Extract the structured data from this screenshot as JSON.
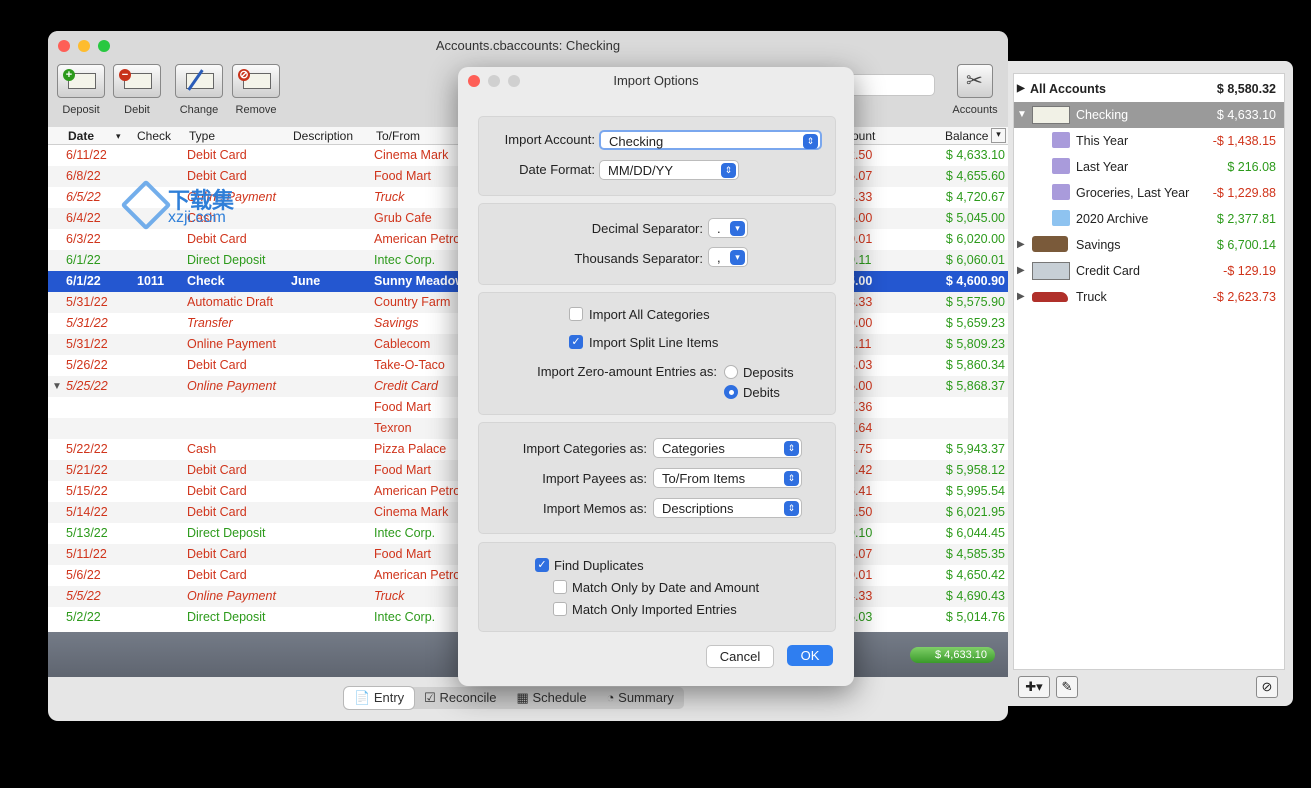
{
  "window": {
    "title": "Accounts.cbaccounts:  Checking"
  },
  "toolbar": {
    "deposit": "Deposit",
    "debit": "Debit",
    "change": "Change",
    "remove": "Remove",
    "accounts": "Accounts"
  },
  "columns": {
    "date": "Date",
    "check": "Check",
    "type": "Type",
    "description": "Description",
    "tofrom": "To/From",
    "amount": "ount",
    "balance": "Balance"
  },
  "rows": [
    {
      "date": "6/11/22",
      "type": "Debit Card",
      "to": "Cinema Mark",
      "amt": "2.50",
      "bal": "$ 4,633.10",
      "c": "red",
      "i": false
    },
    {
      "date": "6/8/22",
      "type": "Debit Card",
      "to": "Food Mart",
      "amt": "5.07",
      "bal": "$ 4,655.60",
      "c": "red",
      "i": false
    },
    {
      "date": "6/5/22",
      "type": "Online Payment",
      "to": "Truck",
      "amt": "4.33",
      "bal": "$ 4,720.67",
      "c": "red",
      "i": true
    },
    {
      "date": "6/4/22",
      "type": "Cash",
      "to": "Grub Cafe",
      "amt": "5.00",
      "bal": "$ 5,045.00",
      "c": "red",
      "i": false
    },
    {
      "date": "6/3/22",
      "type": "Debit Card",
      "to": "American Petro",
      "amt": "0.01",
      "bal": "$ 6,020.00",
      "c": "red",
      "i": false
    },
    {
      "date": "6/1/22",
      "type": "Direct Deposit",
      "to": "Intec Corp.",
      "amt": "9.11",
      "bal": "$ 6,060.01",
      "c": "grn",
      "i": false
    },
    {
      "date": "6/1/22",
      "check": "1011",
      "type": "Check",
      "desc": "June",
      "to": "Sunny Meadow",
      "amt": "5.00",
      "bal": "$ 4,600.90",
      "c": "sel",
      "i": false
    },
    {
      "date": "5/31/22",
      "type": "Automatic Draft",
      "to": "Country Farm",
      "amt": "3.33",
      "bal": "$ 5,575.90",
      "c": "red",
      "i": false
    },
    {
      "date": "5/31/22",
      "type": "Transfer",
      "to": "Savings",
      "amt": "0.00",
      "bal": "$ 5,659.23",
      "c": "red",
      "i": true
    },
    {
      "date": "5/31/22",
      "type": "Online Payment",
      "to": "Cablecom",
      "amt": "1.11",
      "bal": "$ 5,809.23",
      "c": "red",
      "i": false
    },
    {
      "date": "5/26/22",
      "type": "Debit Card",
      "to": "Take-O-Taco",
      "amt": "8.03",
      "bal": "$ 5,860.34",
      "c": "red",
      "i": false
    },
    {
      "date": "5/25/22",
      "type": "Online Payment",
      "to": "Credit Card",
      "amt": "5.00",
      "bal": "$ 5,868.37",
      "c": "red",
      "i": true
    },
    {
      "date": "",
      "type": "",
      "to": "Food Mart",
      "amt": "7.36",
      "bal": "",
      "c": "red",
      "i": false
    },
    {
      "date": "",
      "type": "",
      "to": "Texron",
      "amt": "7.64",
      "bal": "",
      "c": "red",
      "i": false
    },
    {
      "date": "5/22/22",
      "type": "Cash",
      "to": "Pizza Palace",
      "amt": "4.75",
      "bal": "$ 5,943.37",
      "c": "red",
      "i": false
    },
    {
      "date": "5/21/22",
      "type": "Debit Card",
      "to": "Food Mart",
      "amt": "7.42",
      "bal": "$ 5,958.12",
      "c": "red",
      "i": false
    },
    {
      "date": "5/15/22",
      "type": "Debit Card",
      "to": "American Petro",
      "amt": "6.41",
      "bal": "$ 5,995.54",
      "c": "red",
      "i": false
    },
    {
      "date": "5/14/22",
      "type": "Debit Card",
      "to": "Cinema Mark",
      "amt": "2.50",
      "bal": "$ 6,021.95",
      "c": "red",
      "i": false
    },
    {
      "date": "5/13/22",
      "type": "Direct Deposit",
      "to": "Intec Corp.",
      "amt": "9.10",
      "bal": "$ 6,044.45",
      "c": "grn",
      "i": false
    },
    {
      "date": "5/11/22",
      "type": "Debit Card",
      "to": "Food Mart",
      "amt": "5.07",
      "bal": "$ 4,585.35",
      "c": "red",
      "i": false
    },
    {
      "date": "5/6/22",
      "type": "Debit Card",
      "to": "American Petro",
      "amt": "0.01",
      "bal": "$ 4,650.42",
      "c": "red",
      "i": false
    },
    {
      "date": "5/5/22",
      "type": "Online Payment",
      "to": "Truck",
      "amt": "4.33",
      "bal": "$ 4,690.43",
      "c": "red",
      "i": true
    },
    {
      "date": "5/2/22",
      "type": "Direct Deposit",
      "to": "Intec Corp.",
      "amt": "5.03",
      "bal": "$ 5,014.76",
      "c": "grn",
      "i": false
    }
  ],
  "footer": {
    "balance": "$ 4,633.10"
  },
  "tabs": {
    "entry": "Entry",
    "reconcile": "Reconcile",
    "schedule": "Schedule",
    "summary": "Summary"
  },
  "sidebar": {
    "all": {
      "label": "All Accounts",
      "value": "$ 8,580.32"
    },
    "items": [
      {
        "label": "Checking",
        "value": "$ 4,633.10",
        "c": "sel"
      },
      {
        "label": "This Year",
        "value": "-$ 1,438.15",
        "c": "red"
      },
      {
        "label": "Last Year",
        "value": "$ 216.08",
        "c": "grn"
      },
      {
        "label": "Groceries, Last Year",
        "value": "-$ 1,229.88",
        "c": "red"
      },
      {
        "label": "2020 Archive",
        "value": "$ 2,377.81",
        "c": "grn"
      },
      {
        "label": "Savings",
        "value": "$ 6,700.14",
        "c": "grn"
      },
      {
        "label": "Credit Card",
        "value": "-$ 129.19",
        "c": "red"
      },
      {
        "label": "Truck",
        "value": "-$ 2,623.73",
        "c": "red"
      }
    ]
  },
  "dialog": {
    "title": "Import Options",
    "account_label": "Import Account:",
    "account_value": "Checking",
    "date_label": "Date Format:",
    "date_value": "MM/DD/YY",
    "decimal_label": "Decimal Separator:",
    "decimal_value": ".",
    "thousands_label": "Thousands Separator:",
    "thousands_value": ",",
    "all_categories": "Import All Categories",
    "split_items": "Import Split Line Items",
    "zero_label": "Import Zero-amount Entries as:",
    "deposits": "Deposits",
    "debits": "Debits",
    "categories_label": "Import Categories as:",
    "categories_value": "Categories",
    "payees_label": "Import Payees as:",
    "payees_value": "To/From Items",
    "memos_label": "Import Memos as:",
    "memos_value": "Descriptions",
    "find_dups": "Find Duplicates",
    "match_date": "Match Only by Date and Amount",
    "match_imported": "Match Only Imported Entries",
    "cancel": "Cancel",
    "ok": "OK"
  },
  "watermark": {
    "line1": "下载集",
    "line2": "xzji.com"
  },
  "colors": {
    "red": "#d0341b",
    "green": "#2c9a1b",
    "selection": "#2457d0",
    "accent": "#2f6fe0"
  }
}
